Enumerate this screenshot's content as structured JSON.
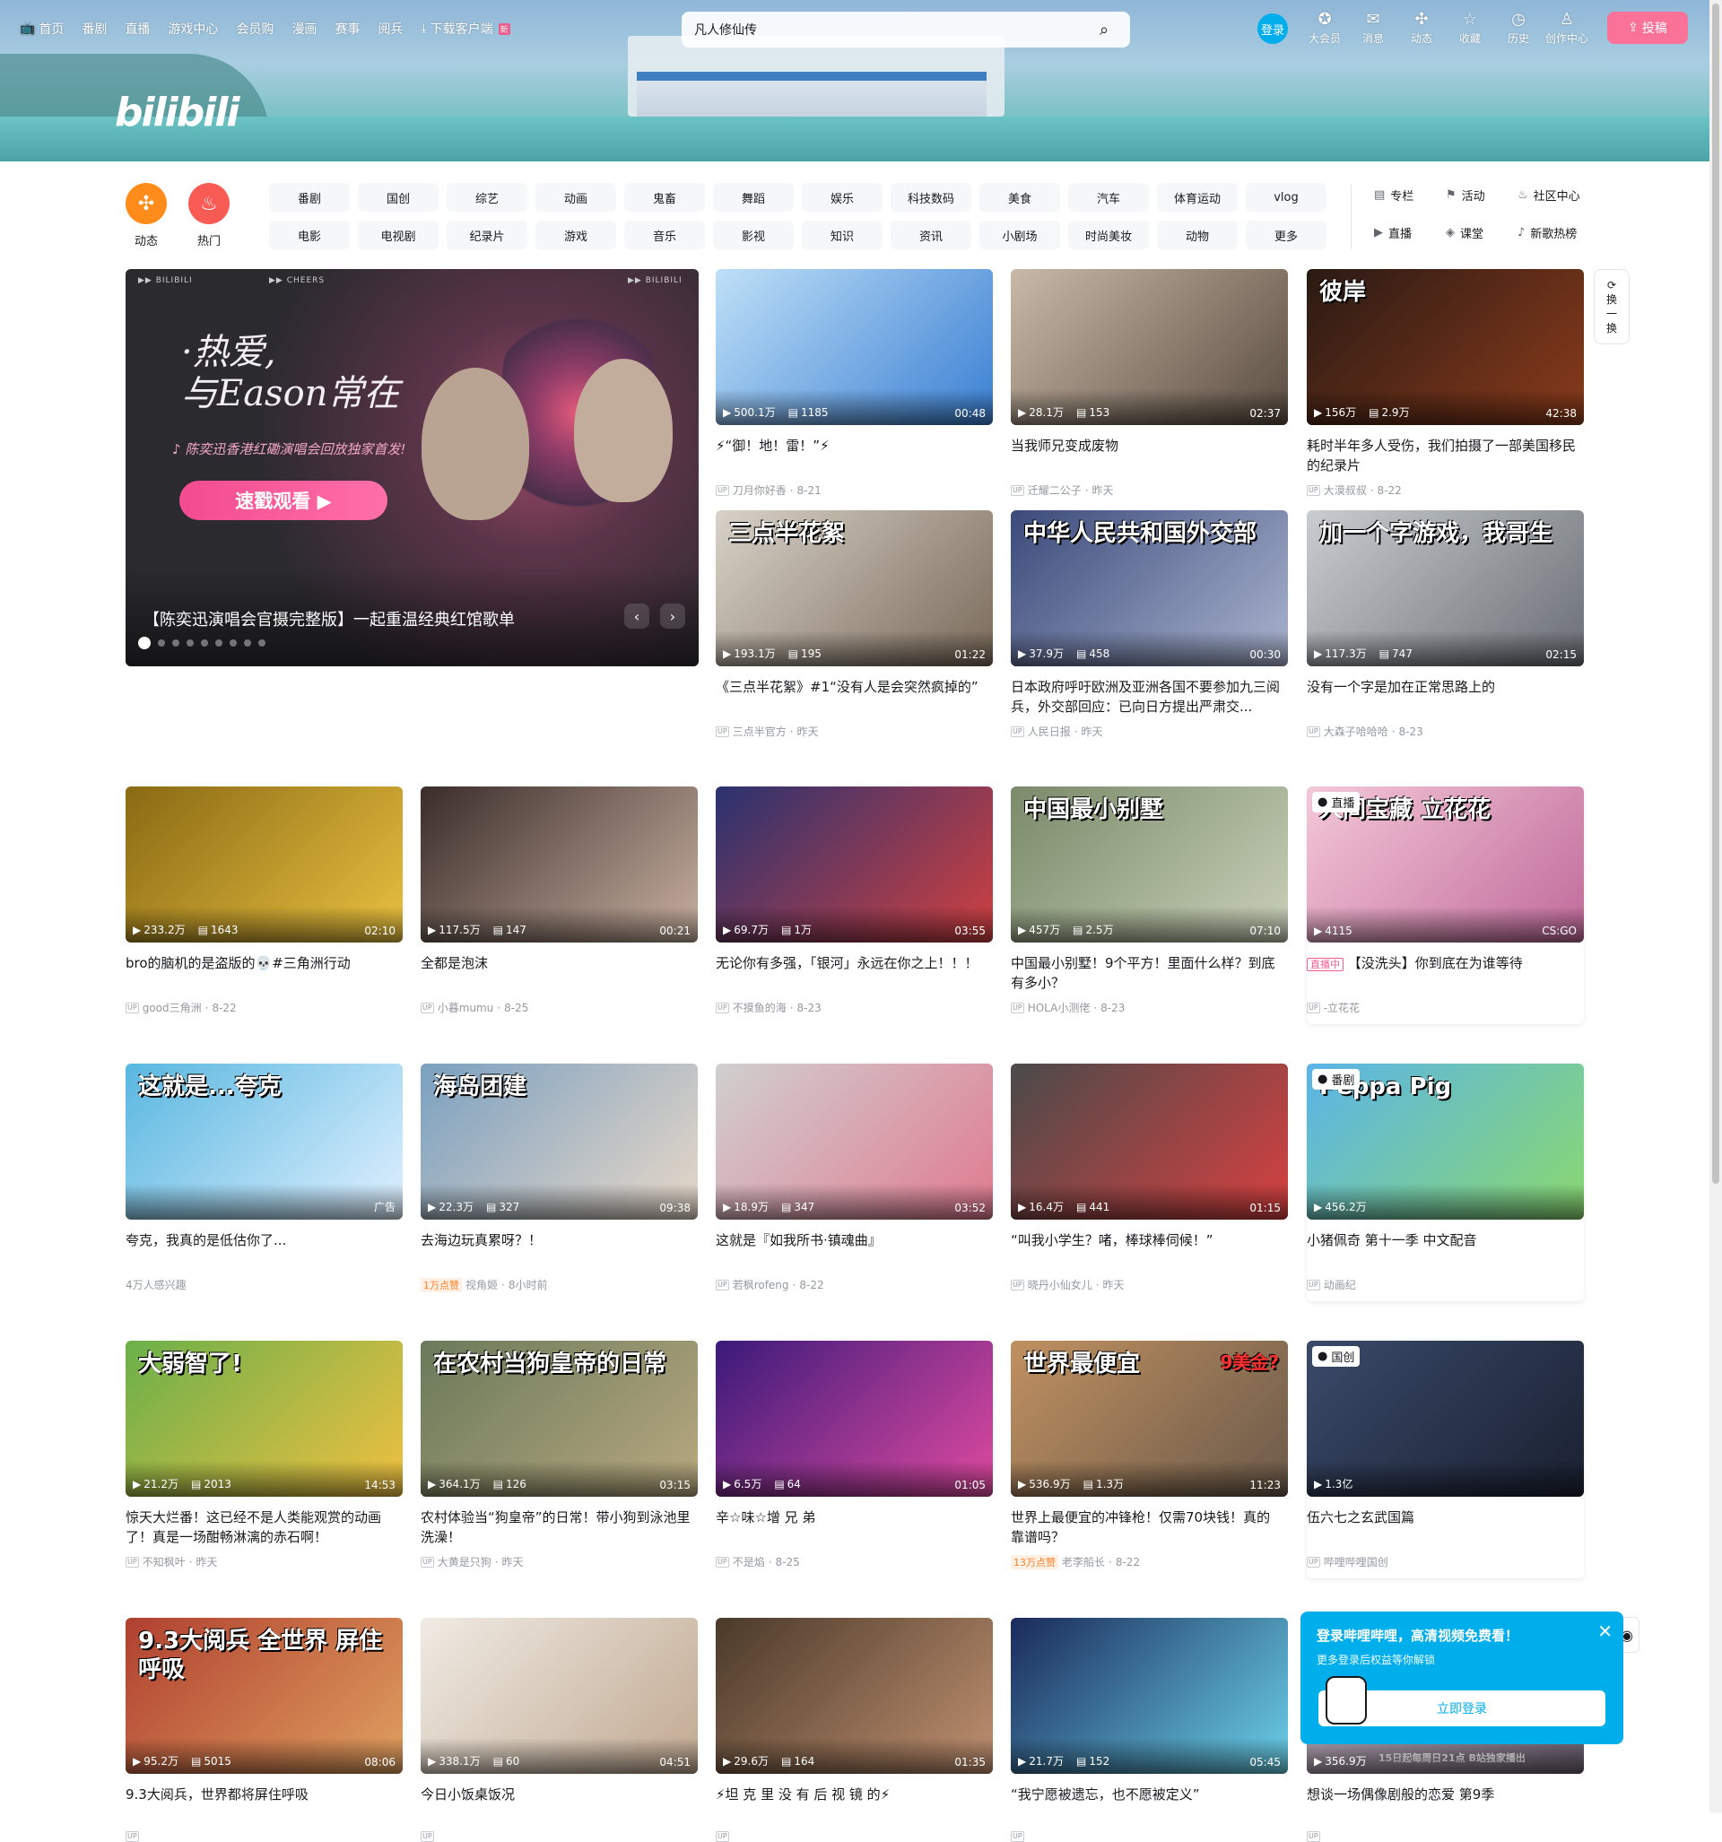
{
  "header": {
    "nav": [
      "首页",
      "番剧",
      "直播",
      "游戏中心",
      "会员购",
      "漫画",
      "赛事",
      "阅兵"
    ],
    "download": "下载客户端",
    "download_badge": "新",
    "search_value": "凡人修仙传",
    "login": "登录",
    "icons": [
      {
        "label": "大会员",
        "icon": "vip-icon",
        "glyph": "✪"
      },
      {
        "label": "消息",
        "icon": "message-icon",
        "glyph": "✉"
      },
      {
        "label": "动态",
        "icon": "dynamic-icon",
        "glyph": "✣"
      },
      {
        "label": "收藏",
        "icon": "favorite-icon",
        "glyph": "☆"
      },
      {
        "label": "历史",
        "icon": "history-icon",
        "glyph": "◷"
      },
      {
        "label": "创作中心",
        "icon": "creator-icon",
        "glyph": "♙"
      }
    ],
    "upload": "投稿",
    "logo": "bilibili"
  },
  "channels": {
    "dynamic": "动态",
    "hot": "热门",
    "items": [
      "番剧",
      "国创",
      "综艺",
      "动画",
      "鬼畜",
      "舞蹈",
      "娱乐",
      "科技数码",
      "美食",
      "汽车",
      "体育运动",
      "vlog",
      "电影",
      "电视剧",
      "纪录片",
      "游戏",
      "音乐",
      "影视",
      "知识",
      "资讯",
      "小剧场",
      "时尚美妆",
      "动物",
      "更多"
    ],
    "extra": [
      {
        "label": "专栏",
        "glyph": "▤"
      },
      {
        "label": "活动",
        "glyph": "⚑"
      },
      {
        "label": "社区中心",
        "glyph": "♨"
      },
      {
        "label": "直播",
        "glyph": "▶"
      },
      {
        "label": "课堂",
        "glyph": "◈"
      },
      {
        "label": "新歌热榜",
        "glyph": "♪"
      }
    ]
  },
  "carousel": {
    "headline1": "·热爱,",
    "headline2": "与Eason常在",
    "sub": "♪ 陈奕迅香港红磡演唱会回放独家首发!",
    "button": "速戳观看 ▶",
    "brand_left": "▶▶ BILIBILI",
    "brand_mid": "▶▶ CHEERS",
    "brand_right": "▶▶ BILIBILI",
    "title": "【陈奕迅演唱会官摄完整版】一起重温经典红馆歌单",
    "prev": "‹",
    "next": "›"
  },
  "refresh": [
    "换",
    "一",
    "换"
  ],
  "videos": [
    {
      "title": "⚡“御！地！雷！”⚡",
      "views": "500.1万",
      "danmaku": "1185",
      "duration": "00:48",
      "author": "刀月你好香",
      "date": "8-21"
    },
    {
      "title": "当我师兄变成废物",
      "views": "28.1万",
      "danmaku": "153",
      "duration": "02:37",
      "author": "迁耀二公子",
      "date": "昨天"
    },
    {
      "title": "耗时半年多人受伤，我们拍摄了一部美国移民的纪录片",
      "views": "156万",
      "danmaku": "2.9万",
      "duration": "42:38",
      "author": "大漠叔叔",
      "date": "8-22",
      "overlay": "彼岸"
    },
    {
      "title": "《三点半花絮》#1“没有人是会突然疯掉的”",
      "views": "193.1万",
      "danmaku": "195",
      "duration": "01:22",
      "author": "三点半官方",
      "date": "昨天",
      "overlay": "三点半花絮"
    },
    {
      "title": "日本政府呼吁欧洲及亚洲各国不要参加九三阅兵，外交部回应：已向日方提出严肃交...",
      "views": "37.9万",
      "danmaku": "458",
      "duration": "00:30",
      "author": "人民日报",
      "date": "昨天",
      "overlay": "中华人民共和国外交部"
    },
    {
      "title": "没有一个字是加在正常思路上的",
      "views": "117.3万",
      "danmaku": "747",
      "duration": "02:15",
      "author": "大森子哈哈哈",
      "date": "8-23",
      "overlay": "加一个字游戏，我哥生"
    },
    {
      "title": "bro的脑机的是盗版的💀#三角洲行动",
      "views": "233.2万",
      "danmaku": "1643",
      "duration": "02:10",
      "author": "good三角洲",
      "date": "8-22"
    },
    {
      "title": "全都是泡沫",
      "views": "117.5万",
      "danmaku": "147",
      "duration": "00:21",
      "author": "小暮mumu",
      "date": "8-25"
    },
    {
      "title": "无论你有多强，「银河」永远在你之上！！！",
      "views": "69.7万",
      "danmaku": "1万",
      "duration": "03:55",
      "author": "不摸鱼的海",
      "date": "8-23"
    },
    {
      "title": "中国最小别墅！9个平方！里面什么样？到底有多小？",
      "views": "457万",
      "danmaku": "2.5万",
      "duration": "07:10",
      "author": "HOLA小测佬",
      "date": "8-23",
      "overlay": "中国最小别墅"
    },
    {
      "title": "【没洗头】你到底在为谁等待",
      "live_badge": "直播中",
      "tag": "直播",
      "views": "4115",
      "duration": "CS:GO",
      "author": "-立花花",
      "overlay": "人间宝藏 立花花"
    },
    {
      "title": "夸克，我真的是低估你了...",
      "tag_right": "广告",
      "meta": "4万人感兴趣",
      "overlay": "这就是...夸克"
    },
    {
      "title": "去海边玩真累呀？！",
      "views": "22.3万",
      "danmaku": "327",
      "duration": "09:38",
      "hot": "1万点赞",
      "author": "视角姬",
      "date": "8小时前",
      "overlay": "海岛团建"
    },
    {
      "title": "这就是『如我所书·镇魂曲』",
      "views": "18.9万",
      "danmaku": "347",
      "duration": "03:52",
      "author": "若枫rofeng",
      "date": "8-22"
    },
    {
      "title": "“叫我小学生？啫，棒球棒伺候！”",
      "views": "16.4万",
      "danmaku": "441",
      "duration": "01:15",
      "author": "晓丹小仙女儿",
      "date": "昨天"
    },
    {
      "title": "小猪佩奇 第十一季 中文配音",
      "tag": "番剧",
      "views": "456.2万",
      "author": "动画纪",
      "overlay": "Peppa Pig"
    },
    {
      "title": "惊天大烂番！这已经不是人类能观赏的动画了！真是一场酣畅淋漓的赤石啊！",
      "views": "21.2万",
      "danmaku": "2013",
      "duration": "14:53",
      "author": "不知枫叶",
      "date": "昨天",
      "overlay": "大弱智了!"
    },
    {
      "title": "农村体验当“狗皇帝”的日常！带小狗到泳池里洗澡！",
      "views": "364.1万",
      "danmaku": "126",
      "duration": "03:15",
      "author": "大黄是只狗",
      "date": "昨天",
      "overlay": "在农村当狗皇帝的日常"
    },
    {
      "title": "辛☆味☆增 兄 弟",
      "views": "6.5万",
      "danmaku": "64",
      "duration": "01:05",
      "author": "不是焰",
      "date": "8-25"
    },
    {
      "title": "世界上最便宜的冲锋枪！仅需70块钱！真的靠谱吗？",
      "views": "536.9万",
      "danmaku": "1.3万",
      "duration": "11:23",
      "hot": "13万点赞",
      "author": "老李船长",
      "date": "8-22",
      "overlay": "世界最便宜",
      "overlay2": "9美金?"
    },
    {
      "title": "伍六七之玄武国篇",
      "tag": "国创",
      "views": "1.3亿",
      "author": "哔哩哔哩国创"
    },
    {
      "title": "9.3大阅兵，世界都将屏住呼吸",
      "views": "95.2万",
      "danmaku": "5015",
      "duration": "08:06",
      "overlay": "9.3大阅兵 全世界 屏住呼吸"
    },
    {
      "title": "今日小饭桌饭况",
      "views": "338.1万",
      "danmaku": "60",
      "duration": "04:51"
    },
    {
      "title": "⚡坦 克 里 没 有 后 视 镜 的⚡",
      "views": "29.6万",
      "danmaku": "164",
      "duration": "01:35"
    },
    {
      "title": "“我宁愿被遗忘，也不愿被定义”",
      "views": "21.7万",
      "danmaku": "152",
      "duration": "05:45"
    },
    {
      "title": "想谈一场偶像剧般的恋爱 第9季",
      "views": "356.9万",
      "caption": "15日起每周日21点 B站独家播出"
    }
  ],
  "popup": {
    "title": "登录哔哩哔哩，高清视频免费看！",
    "subtitle": "更多登录后权益等你解锁",
    "button": "立即登录",
    "close": "✕"
  }
}
